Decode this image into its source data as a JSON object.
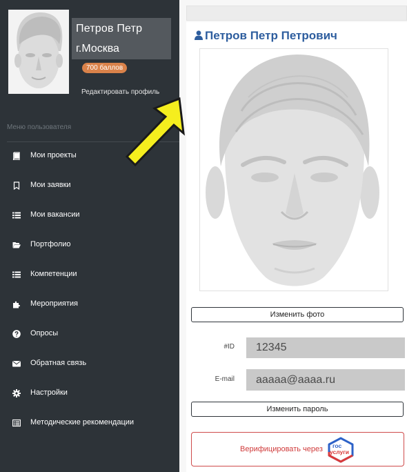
{
  "user": {
    "name": "Петров Петр",
    "city": "г.Москва",
    "points": "700 баллов",
    "edit_profile": "Редактировать профиль"
  },
  "sidebar": {
    "heading": "Меню пользователя",
    "items": [
      {
        "label": "Мои проекты",
        "icon": "book-icon"
      },
      {
        "label": "Мои заявки",
        "icon": "bookmark-icon"
      },
      {
        "label": "Мои вакансии",
        "icon": "list-icon"
      },
      {
        "label": "Портфолио",
        "icon": "folder-open-icon"
      },
      {
        "label": "Компетенции",
        "icon": "list-icon"
      },
      {
        "label": "Мероприятия",
        "icon": "puzzle-icon"
      },
      {
        "label": "Опросы",
        "icon": "question-circle-icon"
      },
      {
        "label": "Обратная связь",
        "icon": "envelope-icon"
      },
      {
        "label": "Настройки",
        "icon": "gear-icon"
      },
      {
        "label": "Методические рекомендации",
        "icon": "list-alt-icon"
      }
    ]
  },
  "profile": {
    "title": "Петров Петр Петрович",
    "change_photo": "Изменить фото",
    "id_label": "#ID",
    "id_value": "12345",
    "email_label": "E-mail",
    "email_value": "aaaaa@aaaa.ru",
    "change_password": "Изменить пароль",
    "verify_label": "Верифицировать через",
    "gosuslugi_logo": [
      "гос",
      "услуги"
    ]
  },
  "colors": {
    "sidebar_bg": "#2d3338",
    "accent_blue": "#2d5d9e",
    "badge_orange": "#d9824a",
    "verify_red": "#d03b3b",
    "arrow_yellow": "#f5ee1e"
  }
}
